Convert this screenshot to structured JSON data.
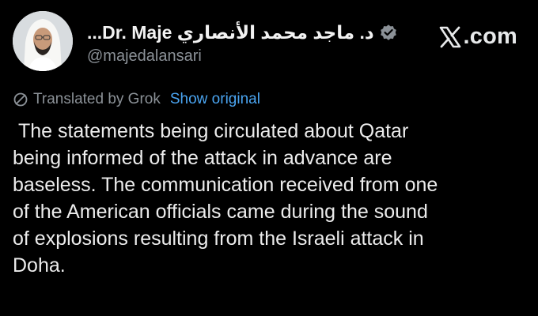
{
  "author": {
    "display_name": "د. ماجد محمد الأنصاري Dr. Maje...",
    "handle": "@majedalansari",
    "verified": true,
    "verified_icon": "verified-badge-icon",
    "avatar_icon": "profile-photo"
  },
  "site": {
    "logo_icon": "x-logo-icon",
    "domain": ".com"
  },
  "translation": {
    "icon": "translate-off-icon",
    "label": "Translated by Grok",
    "show_original_label": "Show original"
  },
  "tweet": {
    "text": " The statements being circulated about Qatar\nbeing informed of the attack in advance are\nbaseless. The communication received from one\nof the American officials came during the sound\nof explosions resulting from the Israeli attack in\nDoha."
  },
  "colors": {
    "background": "#000000",
    "text": "#e7e9ea",
    "secondary": "#8b9197",
    "link": "#4aa4f0",
    "verified": "#8b9197"
  }
}
